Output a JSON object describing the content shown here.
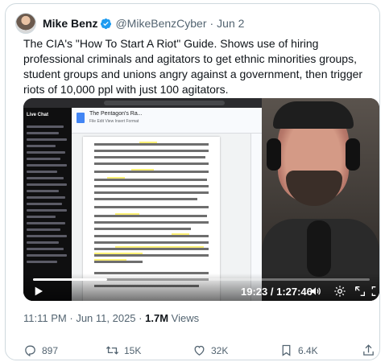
{
  "author": {
    "name": "Mike Benz",
    "handle": "@MikeBenzCyber",
    "separator": "·",
    "date": "Jun 2"
  },
  "tweet": {
    "text": "The CIA's \"How To Start A Riot\" Guide. Shows use of hiring professional criminals and agitators to get ethnic minorities groups, student groups and unions angry against a government, then trigger riots of 10,000 ppl with just 100 agitators."
  },
  "video": {
    "time": "19:23 / 1:27:46",
    "progress": 0.22,
    "chat_title": "Live Chat",
    "doc_title": "The Pentagon's Ra...",
    "doc_menu": "File  Edit  View  Insert  Format"
  },
  "meta": {
    "time": "11:11 PM",
    "separator": "·",
    "date": "Jun 11, 2025",
    "views_count": "1.7M",
    "views_label": "Views"
  },
  "actions": {
    "replies": "897",
    "reposts": "15K",
    "likes": "32K",
    "bookmarks": "6.4K"
  },
  "colors": {
    "verified": "#1d9bf0",
    "text_secondary": "#536471",
    "border": "#cfd9de"
  }
}
